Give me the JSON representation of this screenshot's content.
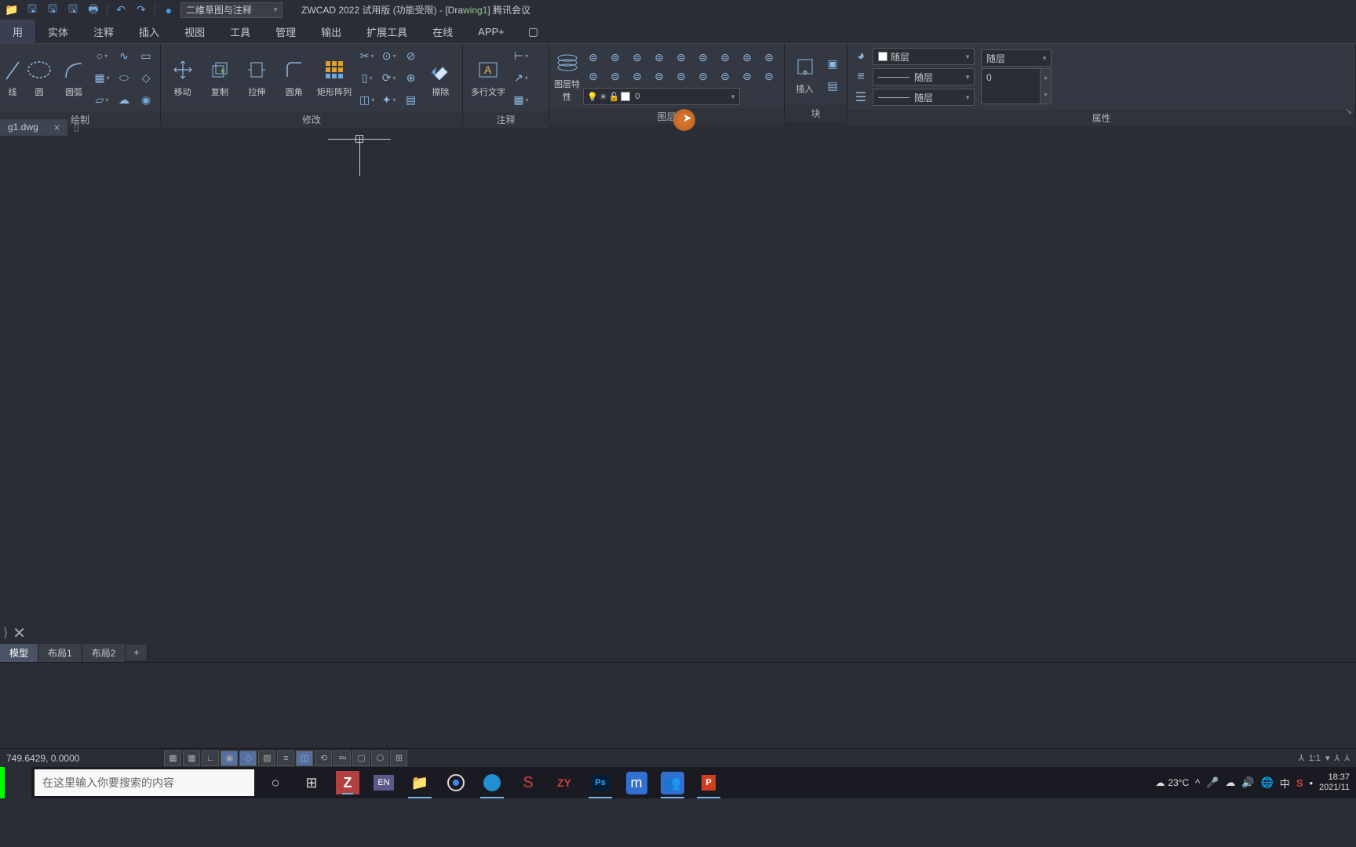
{
  "titlebar": {
    "workspace": "二维草图与注释",
    "app_title": "ZWCAD 2022 试用版 (功能受限) - [Dra",
    "app_title_highlight": "wing1",
    "app_title_suffix": "] 腾讯会议"
  },
  "menubar": {
    "items": [
      "用",
      "实体",
      "注释",
      "插入",
      "视图",
      "工具",
      "管理",
      "输出",
      "扩展工具",
      "在线",
      "APP+"
    ]
  },
  "ribbon": {
    "panels": [
      {
        "title": "绘制",
        "buttons": [
          "线",
          "圆",
          "圆弧"
        ]
      },
      {
        "title": "修改",
        "buttons": [
          "移动",
          "复制",
          "拉伸",
          "圆角",
          "矩形阵列",
          "擦除"
        ]
      },
      {
        "title": "注释",
        "buttons": [
          "多行文字"
        ]
      },
      {
        "title": "图层",
        "buttons": [
          "图层特性"
        ],
        "layer_combo": "0"
      },
      {
        "title": "块",
        "buttons": [
          "插入"
        ]
      },
      {
        "title": "属性",
        "color_label": "随层",
        "ltype_label": "随层",
        "lweight_label": "随层",
        "plot_label": "随层",
        "value": "0"
      }
    ]
  },
  "filetabs": {
    "active": "g1.dwg"
  },
  "model_tabs": [
    "模型",
    "布局1",
    "布局2",
    "+"
  ],
  "statusbar": {
    "coords": "749.6429, 0.0000",
    "scale": "1:1"
  },
  "taskbar": {
    "search_placeholder": "在这里输入你要搜索的内容",
    "weather": "23°C",
    "ime": "中",
    "time": "18:37",
    "date": "2021/11"
  }
}
